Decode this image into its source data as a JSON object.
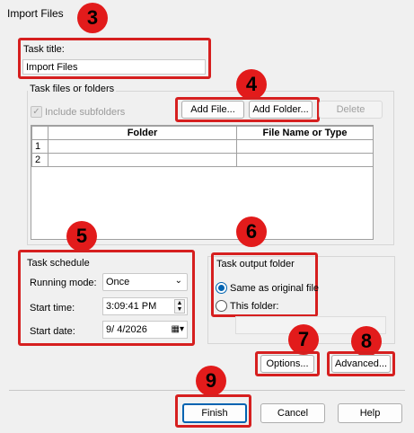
{
  "window": {
    "title": "Import Files"
  },
  "callouts": [
    "3",
    "4",
    "5",
    "6",
    "7",
    "8",
    "9"
  ],
  "task_title": {
    "label": "Task title:",
    "value": "Import Files"
  },
  "files_group": {
    "label": "Task files or folders",
    "include_subfolders": "Include subfolders",
    "add_file": "Add File...",
    "add_folder": "Add Folder...",
    "delete": "Delete",
    "table": {
      "headers": [
        "Folder",
        "File Name or Type"
      ],
      "rows": [
        {
          "n": "1"
        },
        {
          "n": "2"
        }
      ]
    }
  },
  "schedule": {
    "label": "Task schedule",
    "running_mode_label": "Running mode:",
    "running_mode_value": "Once",
    "start_time_label": "Start time:",
    "start_time_value": "3:09:41 PM",
    "start_date_label": "Start date:",
    "start_date_value": "9/  4/2026"
  },
  "output": {
    "label": "Task output folder",
    "same_as_original": "Same as original file",
    "this_folder": "This folder:"
  },
  "buttons": {
    "options": "Options...",
    "advanced": "Advanced...",
    "finish": "Finish",
    "cancel": "Cancel",
    "help": "Help"
  },
  "colors": {
    "accent": "#0063b1",
    "callout": "#e21b1b",
    "highlight": "#d61f1f"
  }
}
